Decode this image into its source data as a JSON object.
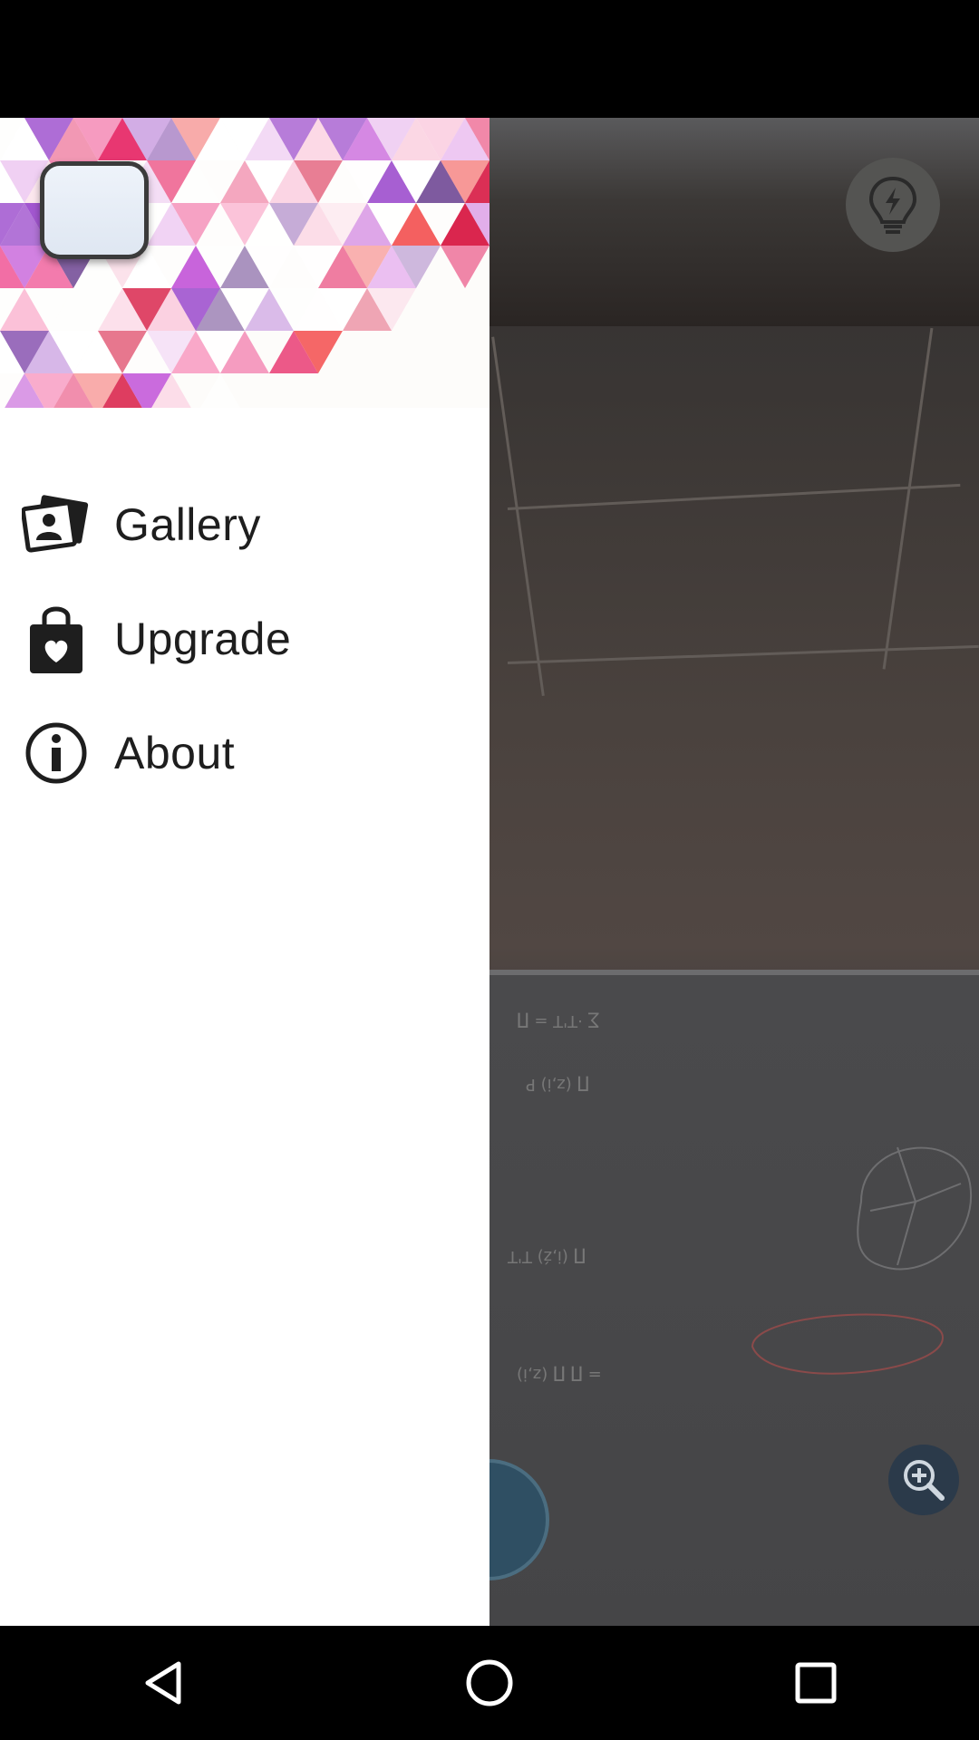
{
  "drawer": {
    "menu": [
      {
        "label": "Gallery",
        "icon": "gallery-icon"
      },
      {
        "label": "Upgrade",
        "icon": "shopping-bag-heart-icon"
      },
      {
        "label": "About",
        "icon": "info-icon"
      }
    ]
  },
  "camera": {
    "controls": [
      "flash-bulb-icon",
      "zoom-in-icon",
      "camera-icon",
      "settings-icon"
    ]
  },
  "navigation": [
    "back-icon",
    "home-icon",
    "recents-icon"
  ],
  "colors": {
    "header_pattern": [
      "#e8336e",
      "#f26ba3",
      "#c04fd6",
      "#5b2e86",
      "#d9224a"
    ],
    "drawer_bg": "#ffffff"
  }
}
